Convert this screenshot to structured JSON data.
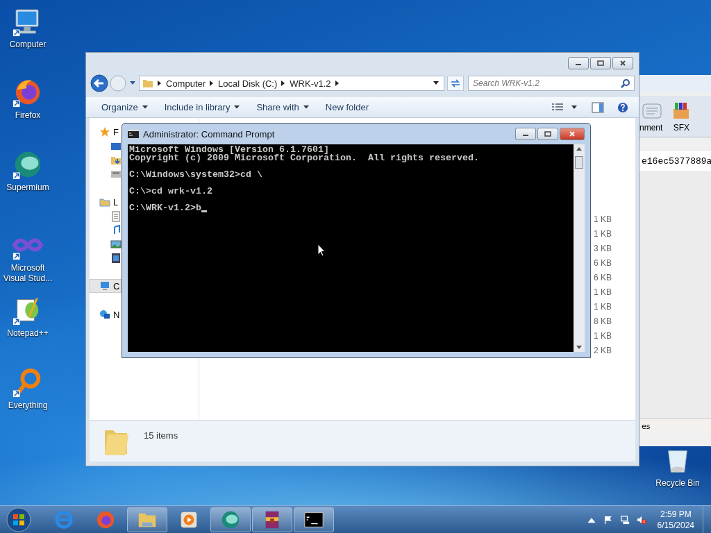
{
  "desktop_icons": [
    {
      "label": "Computer",
      "kind": "computer"
    },
    {
      "label": "Firefox",
      "kind": "firefox"
    },
    {
      "label": "Supermium",
      "kind": "supermium"
    },
    {
      "label": "Microsoft Visual Stud...",
      "kind": "vs"
    },
    {
      "label": "Notepad++",
      "kind": "notepad"
    },
    {
      "label": "Everything",
      "kind": "everything"
    }
  ],
  "recycle_bin": {
    "label": "Recycle Bin"
  },
  "back_window": {
    "toolbar": [
      "nment",
      "SFX"
    ],
    "text": "e16ec5377889a",
    "status": "es"
  },
  "explorer": {
    "breadcrumb": [
      "Computer",
      "Local Disk (C:)",
      "WRK-v1.2"
    ],
    "search": {
      "placeholder": "Search WRK-v1.2"
    },
    "toolbar": [
      {
        "label": "Organize",
        "menu": true
      },
      {
        "label": "Include in library",
        "menu": true
      },
      {
        "label": "Share with",
        "menu": true
      },
      {
        "label": "New folder",
        "menu": false
      }
    ],
    "nav": [
      {
        "label": "F",
        "kind": "favorites",
        "selected": false,
        "children": [
          {
            "kind": "desktop"
          },
          {
            "kind": "downloads"
          },
          {
            "kind": "recent"
          }
        ]
      },
      {
        "label": "L",
        "kind": "libraries",
        "selected": false,
        "children": [
          {
            "kind": "documents"
          },
          {
            "kind": "music"
          },
          {
            "kind": "pictures"
          },
          {
            "kind": "videos"
          }
        ]
      },
      {
        "label": "C",
        "kind": "computer",
        "selected": true
      },
      {
        "label": "N",
        "kind": "network",
        "selected": false
      }
    ],
    "sizes": [
      "1 KB",
      "1 KB",
      "3 KB",
      "6 KB",
      "6 KB",
      "1 KB",
      "1 KB",
      "8 KB",
      "1 KB",
      "2 KB"
    ],
    "status": "15 items"
  },
  "cmd": {
    "title": "Administrator: Command Prompt",
    "blocks": [
      [
        "Microsoft Windows [Version 6.1.7601]",
        "Copyright (c) 2009 Microsoft Corporation.  All rights reserved."
      ],
      [
        "C:\\Windows\\system32>cd \\"
      ],
      [
        "C:\\>cd wrk-v1.2"
      ],
      [
        "C:\\WRK-v1.2>b"
      ]
    ],
    "cursor": true
  },
  "taskbar": {
    "items": [
      {
        "kind": "ie",
        "open": false
      },
      {
        "kind": "firefox",
        "open": false
      },
      {
        "kind": "explorer",
        "open": true
      },
      {
        "kind": "media",
        "open": false
      },
      {
        "kind": "supermium",
        "open": true
      },
      {
        "kind": "winrar",
        "open": true
      },
      {
        "kind": "cmd",
        "open": true
      }
    ],
    "time": "2:59 PM",
    "date": "6/15/2024"
  }
}
